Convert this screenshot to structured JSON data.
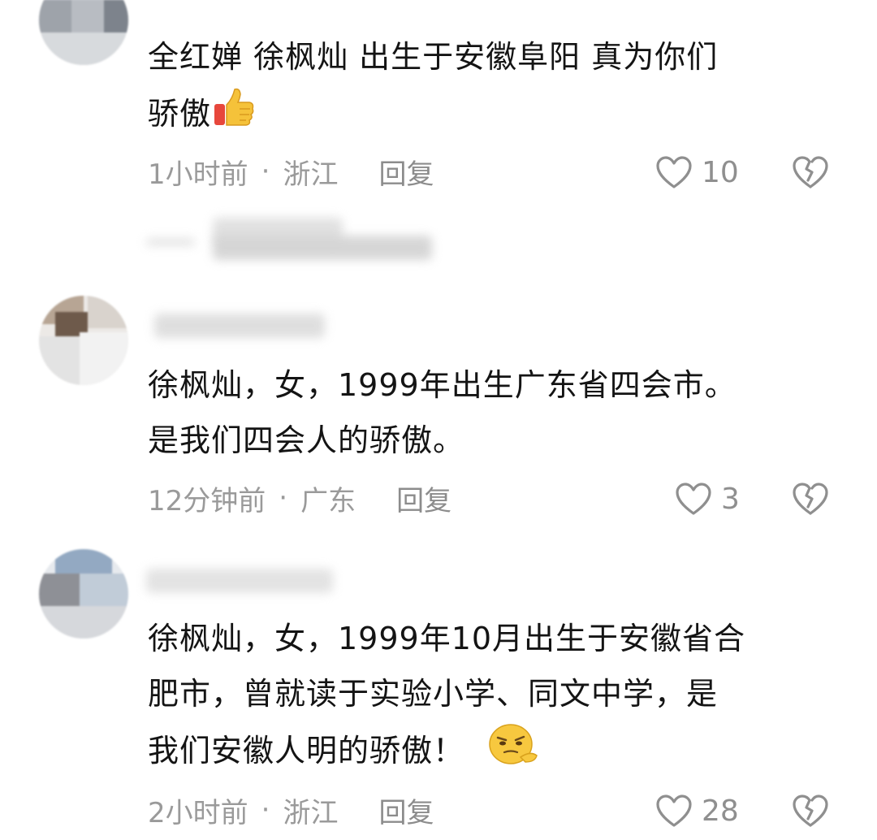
{
  "comments": [
    {
      "text_line1": "全红婵  徐枫灿 出生于安徽阜阳 真为你们",
      "text_line2": "骄傲",
      "emoji": "thumbs-up",
      "time": "1小时前",
      "location": "浙江",
      "reply": "回复",
      "likes": "10"
    },
    {
      "text_line1": "徐枫灿，女，1999年出生广东省四会市。",
      "text_line2": "是我们四会人的骄傲。",
      "time": "12分钟前",
      "location": "广东",
      "reply": "回复",
      "likes": "3"
    },
    {
      "text_line1": "徐枫灿，女，1999年10月出生于安徽省合",
      "text_line2": "肥市，曾就读于实验小学、同文中学，是",
      "text_line3": "我们安徽人明的骄傲！",
      "emoji": "smug-face",
      "time": "2小时前",
      "location": "浙江",
      "reply": "回复",
      "likes": "28"
    }
  ],
  "separator": "·",
  "colors": {
    "meta": "#9a9a9a",
    "text": "#141414",
    "icon": "#8f8f8f"
  },
  "icons": {
    "like": "heart-outline-icon",
    "dislike": "broken-heart-icon"
  }
}
